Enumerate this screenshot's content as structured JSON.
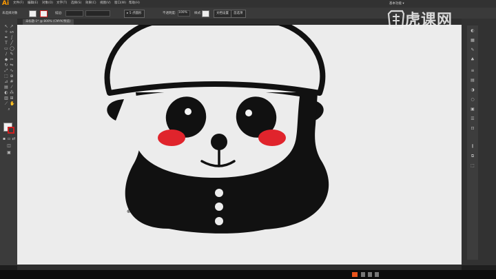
{
  "app": {
    "logo": "Ai",
    "workspace": "基本功能 ▾"
  },
  "menu": [
    "文件(F)",
    "编辑(E)",
    "对象(O)",
    "文字(T)",
    "选择(S)",
    "效果(C)",
    "视图(V)",
    "窗口(W)",
    "帮助(H)"
  ],
  "control_bar": {
    "selection_label": "未选择对象",
    "stroke_label": "描边:",
    "mode": "5 点圆形",
    "opacity_label": "不透明度:",
    "opacity_value": "100%",
    "style_label": "样式:",
    "doc_setup": "文档设置",
    "prefs": "首选项"
  },
  "document_tab": {
    "label": "未标题-1* @ 800% (CMYK/预览)"
  },
  "watermark": {
    "text": "虎课网"
  },
  "colors": {
    "canvas": "#ececec",
    "ink": "#111111",
    "blush": "#e0242c",
    "stroke_swatch": "#d02020",
    "logo": "#ff9a00"
  },
  "icons": {
    "tools": [
      "selection-arrow-icon",
      "direct-select-icon",
      "magic-wand-icon",
      "lasso-icon",
      "pen-icon",
      "type-icon",
      "line-icon",
      "rectangle-icon",
      "brush-icon",
      "pencil-icon",
      "eraser-icon",
      "rotate-icon",
      "scale-icon",
      "warp-icon",
      "free-transform-icon",
      "shape-builder-icon",
      "perspective-icon",
      "mesh-icon",
      "gradient-icon",
      "eyedropper-icon",
      "blend-icon",
      "symbol-sprayer-icon",
      "graph-icon",
      "artboard-icon",
      "slice-icon",
      "hand-icon",
      "zoom-icon"
    ],
    "panels": [
      "color-panel-icon",
      "swatches-panel-icon",
      "brushes-panel-icon",
      "symbols-panel-icon",
      "stroke-panel-icon",
      "gradient-panel-icon",
      "transparency-panel-icon",
      "appearance-panel-icon",
      "graphic-styles-panel-icon",
      "layers-panel-icon",
      "artboards-panel-icon",
      "align-panel-icon",
      "pathfinder-panel-icon",
      "transform-panel-icon"
    ]
  }
}
